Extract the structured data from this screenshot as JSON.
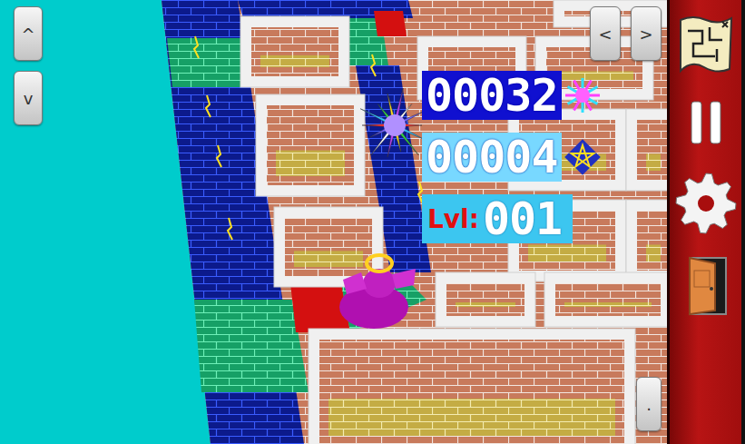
{
  "camera_buttons": [
    {
      "label": "^"
    },
    {
      "label": "v"
    }
  ],
  "rotate_buttons": [
    {
      "label": "<"
    },
    {
      "label": ">"
    }
  ],
  "hud": {
    "gems": "00032",
    "stars": "00004",
    "level_label": "Lvl:",
    "level": "001"
  },
  "corner_button": {
    "label": "."
  }
}
